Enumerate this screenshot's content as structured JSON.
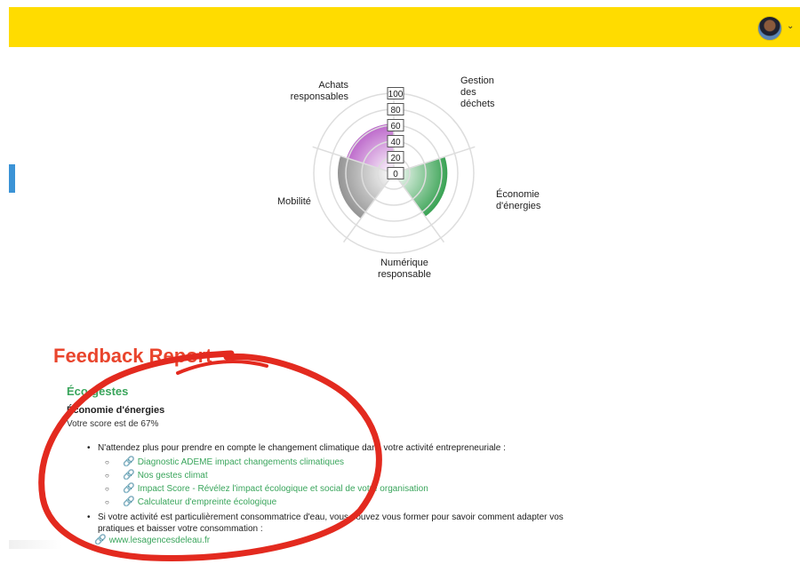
{
  "header": {
    "avatar_label": "user-avatar",
    "caret": "⌄"
  },
  "chart_data": {
    "type": "polar-area",
    "categories": [
      "Achats responsables",
      "Gestion des déchets",
      "Économie d'énergies",
      "Numérique responsable",
      "Mobilité"
    ],
    "values": [
      62,
      0,
      67,
      0,
      70
    ],
    "colors": [
      "#b85fc7",
      "#cccccc",
      "#2e9d4a",
      "#cccccc",
      "#8e8e8e"
    ],
    "rlim": [
      0,
      100
    ],
    "ticks": [
      0,
      20,
      40,
      60,
      80,
      100
    ],
    "labels": {
      "achats": [
        "Achats",
        "responsables"
      ],
      "gestion": [
        "Gestion",
        "des",
        "déchets"
      ],
      "economie": [
        "Économie",
        "d'énergies"
      ],
      "numerique": [
        "Numérique",
        "responsable"
      ],
      "mobilite": [
        "Mobilité"
      ]
    }
  },
  "report": {
    "title": "Feedback Report",
    "section": "Éco-gestes",
    "subsection": "Économie d'énergies",
    "score": "Votre score est de 67%",
    "tip1": "N'attendez plus pour prendre en compte le changement climatique dans votre activité entrepreneuriale :",
    "links": [
      "Diagnostic ADEME impact changements climatiques",
      "Nos gestes climat",
      "Impact Score - Révélez l'impact écologique et social de votre organisation",
      "Calculateur d'empreinte écologique"
    ],
    "tip2_line1": "Si votre activité est particulièrement consommatrice d'eau, vous pouvez vous former pour savoir comment adapter vos",
    "tip2_line2": "pratiques et baisser votre consommation :",
    "water_link": "www.lesagencesdeleau.fr",
    "link_icon": "link-icon"
  },
  "annotation_color": "#e32a1f"
}
